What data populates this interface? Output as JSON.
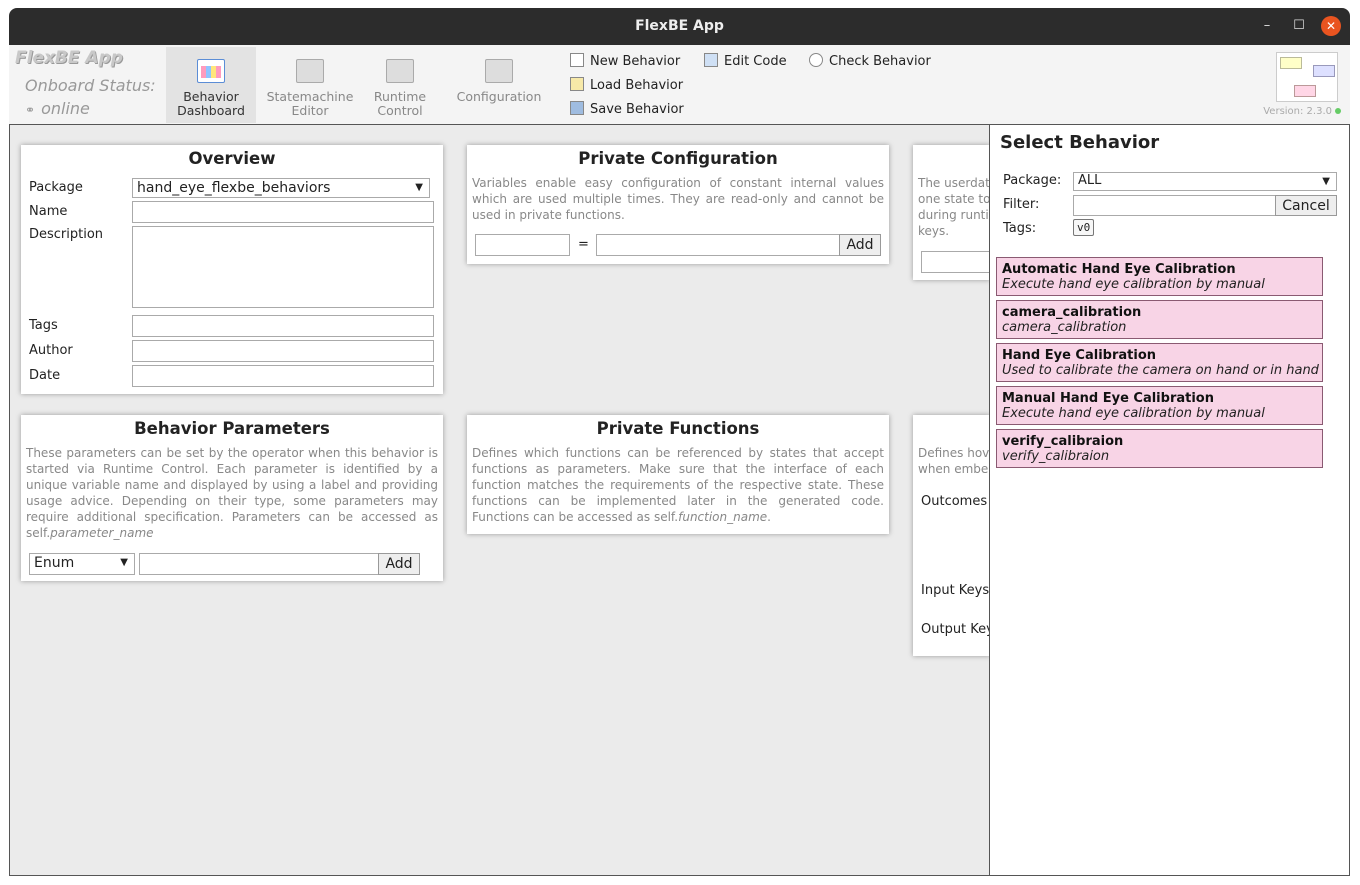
{
  "window": {
    "title": "FlexBE App",
    "minimize": "–",
    "maximize": "☐",
    "close": "✕"
  },
  "header": {
    "logo": "FlexBE  App",
    "status_label": "Onboard Status:",
    "status_icon": "⚭",
    "status_value": "online",
    "version": "Version: 2.3.0"
  },
  "nav": [
    {
      "line1": "Behavior",
      "line2": "Dashboard"
    },
    {
      "line1": "Statemachine",
      "line2": "Editor"
    },
    {
      "line1": "Runtime",
      "line2": "Control"
    },
    {
      "line1": "Configuration",
      "line2": ""
    }
  ],
  "tools": {
    "new_behavior": "New Behavior",
    "load_behavior": "Load Behavior",
    "save_behavior": "Save Behavior",
    "edit_code": "Edit Code",
    "check_behavior": "Check Behavior"
  },
  "overview": {
    "title": "Overview",
    "package_label": "Package",
    "package_value": "hand_eye_flexbe_behaviors",
    "name_label": "Name",
    "description_label": "Description",
    "tags_label": "Tags",
    "author_label": "Author",
    "date_label": "Date"
  },
  "private_config": {
    "title": "Private Configuration",
    "desc": "Variables enable easy configuration of constant internal values which are used multiple times. They are read-only and cannot be used in private functions.",
    "equals": "=",
    "add": "Add"
  },
  "userdata": {
    "desc_lines": [
      "The userdat",
      "one state to",
      "during runti",
      "keys."
    ]
  },
  "behavior_params": {
    "title": "Behavior Parameters",
    "desc": "These parameters can be set by the operator when this behavior is started via Runtime Control. Each parameter is identified by a unique variable name and displayed by using a label and providing usage advice. Depending on their type, some parameters may require additional specification. Parameters can be accessed as self.",
    "desc_em": "parameter_name",
    "type_value": "Enum",
    "add": "Add"
  },
  "private_functions": {
    "title": "Private Functions",
    "desc": "Defines which functions can be referenced by states that accept functions as parameters. Make sure that the interface of each function matches the requirements of the respective state. These functions can be implemented later in the generated code. Functions can be accessed as self.",
    "desc_em": "function_name",
    "desc_end": "."
  },
  "interface": {
    "desc_lines": [
      "Defines hov",
      "when embe"
    ],
    "outcomes": "Outcomes",
    "input_keys": "Input Keys",
    "output_keys": "Output Keys"
  },
  "select_behavior": {
    "title": "Select Behavior",
    "package_label": "Package:",
    "package_value": "ALL",
    "filter_label": "Filter:",
    "filter_value": "",
    "cancel": "Cancel",
    "tags_label": "Tags:",
    "tag": "v0",
    "items": [
      {
        "name": "Automatic Hand Eye Calibration",
        "desc": "Execute hand eye calibration by manual"
      },
      {
        "name": "camera_calibration",
        "desc": "camera_calibration"
      },
      {
        "name": "Hand Eye Calibration",
        "desc": "Used to calibrate the camera on hand or in hand"
      },
      {
        "name": "Manual Hand Eye Calibration",
        "desc": "Execute hand eye calibration by manual"
      },
      {
        "name": "verify_calibraion",
        "desc": "verify_calibraion"
      }
    ]
  },
  "colors": {
    "behavior_item": "#f8d4e6",
    "close_button": "#e95420",
    "titlebar": "#2c2c2c"
  }
}
